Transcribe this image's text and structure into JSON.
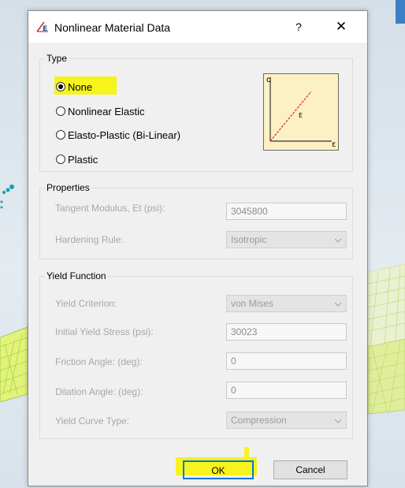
{
  "dialog": {
    "title": "Nonlinear Material Data",
    "help_label": "?",
    "close_label": "✕"
  },
  "type_group": {
    "legend": "Type",
    "options": [
      {
        "label": "None",
        "selected": true
      },
      {
        "label": "Nonlinear Elastic",
        "selected": false
      },
      {
        "label": "Elasto-Plastic (Bi-Linear)",
        "selected": false
      },
      {
        "label": "Plastic",
        "selected": false
      }
    ],
    "diagram": {
      "sigma": "σ",
      "epsilon": "ε",
      "modulus": "E"
    }
  },
  "properties": {
    "legend": "Properties",
    "tangent_modulus_label": "Tangent Modulus, Et (psi):",
    "tangent_modulus_value": "3045800",
    "hardening_rule_label": "Hardening Rule:",
    "hardening_rule_value": "Isotropic"
  },
  "yield_function": {
    "legend": "Yield Function",
    "yield_criterion_label": "Yield Criterion:",
    "yield_criterion_value": "von Mises",
    "initial_yield_stress_label": "Initial Yield Stress (psi):",
    "initial_yield_stress_value": "30023",
    "friction_angle_label": "Friction Angle: (deg):",
    "friction_angle_value": "0",
    "dilation_angle_label": "Dilation Angle: (deg):",
    "dilation_angle_value": "0",
    "yield_curve_type_label": "Yield Curve Type:",
    "yield_curve_type_value": "Compression"
  },
  "buttons": {
    "ok_label": "OK",
    "cancel_label": "Cancel"
  },
  "colors": {
    "highlight": "#f7f31d",
    "focus_border": "#0078d7",
    "diagram_background": "#fcf1c4",
    "diagram_line": "#e8322e"
  }
}
